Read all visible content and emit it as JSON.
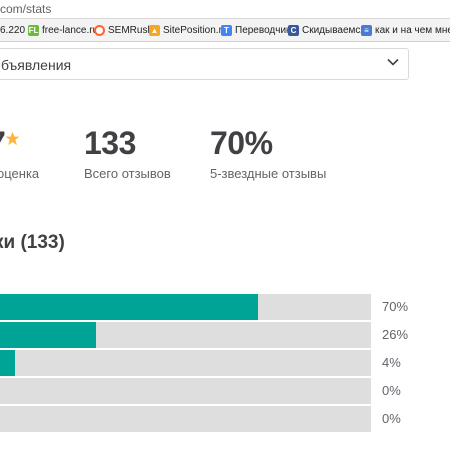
{
  "browser": {
    "url": "com/stats",
    "bookmarks": [
      {
        "label": "6.220",
        "icon": "none",
        "color": "#ffffff"
      },
      {
        "label": "free-lance.ru",
        "icon": "fl-logo-icon",
        "color": "#6fb83f"
      },
      {
        "label": "SEMRush",
        "icon": "semrush-icon",
        "color": "#ff642d"
      },
      {
        "label": "SitePosition.ru",
        "icon": "siteposition-icon",
        "color": "#f5a623"
      },
      {
        "label": "Переводчик",
        "icon": "translate-icon",
        "color": "#4285f4"
      },
      {
        "label": "Скидываемся",
        "icon": "skidyvaemsya-icon",
        "color": "#3b5998"
      },
      {
        "label": "как и на чем мне зар",
        "icon": "page-icon",
        "color": "#4a7bd4"
      }
    ]
  },
  "filter": {
    "selected": "бъявления"
  },
  "stats": {
    "rating_value": "7",
    "rating_label": "оценка",
    "total_value": "133",
    "total_label": "Всего отзывов",
    "five_star_value": "70%",
    "five_star_label": "5-звездные отзывы"
  },
  "section": {
    "title": "ки (133)"
  },
  "colors": {
    "accent": "#00a497",
    "track": "#dedede",
    "star": "#ffb33e"
  },
  "distribution": [
    {
      "percent": 70,
      "label": "70%"
    },
    {
      "percent": 26,
      "label": "26%"
    },
    {
      "percent": 4,
      "label": "4%"
    },
    {
      "percent": 0,
      "label": "0%"
    },
    {
      "percent": 0,
      "label": "0%"
    }
  ]
}
